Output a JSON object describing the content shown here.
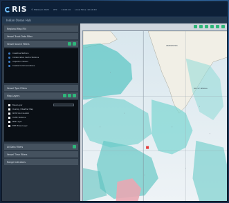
{
  "topbar": {
    "logo_text": "RIS",
    "meta": [
      "© Platinum 2022",
      "UTC",
      "10:02:10",
      "Local Time: 10:10:10"
    ]
  },
  "subbar": {
    "title": "Indian Ocean Hub"
  },
  "regional_map": {
    "label": "Regional Map",
    "sub": "FIN"
  },
  "filters": {
    "panels": [
      {
        "title": "Vessel Track Data Filter",
        "name": "vessel-track-data-filter"
      },
      {
        "title": "Vessel Source Filters",
        "name": "vessel-source-filters",
        "items": [
          "Coastline Stations",
          "Collaborative Centre Stations",
          "Inspection Vessel",
          "Coastal Communications"
        ]
      },
      {
        "title": "Vessel Type Filters",
        "name": "vessel-type-filters"
      },
      {
        "title": "Map Layers",
        "name": "map-layers",
        "items": [
          "Base Layer",
          "Overlay / Weather Map",
          "MPHP OLD GUARD",
          "Traffic Stations",
          "MPZ Layer",
          "EEZ Phase Layer"
        ]
      },
      {
        "title": "All Data Filters",
        "name": "all-data-filters"
      },
      {
        "title": "Vessel Time Filters",
        "name": "vessel-time-filters"
      },
      {
        "title": "Range Indicators",
        "name": "range-indicators"
      }
    ]
  },
  "map": {
    "labels": [
      "ARABIAN SEA",
      "BAY OF BENGAL"
    ]
  }
}
